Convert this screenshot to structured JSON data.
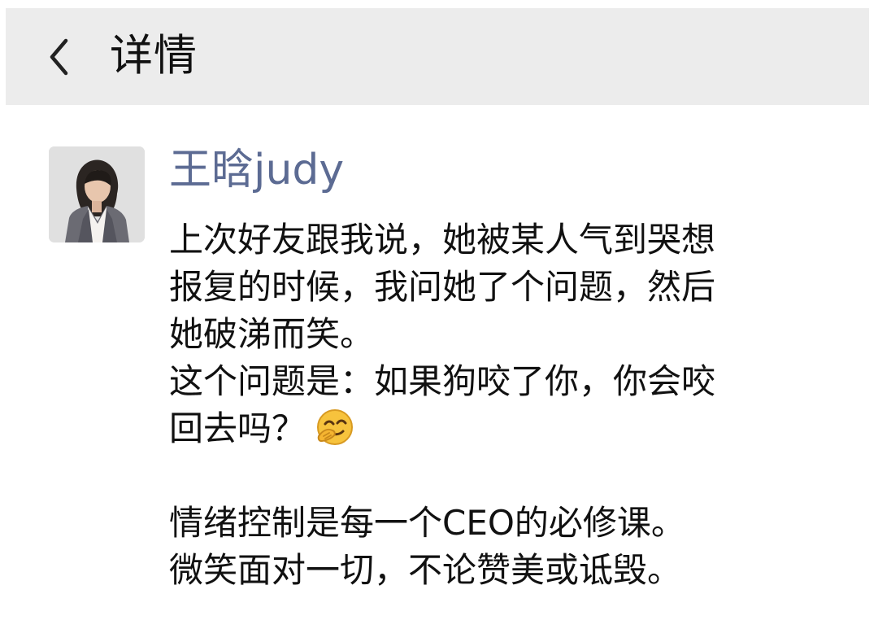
{
  "header": {
    "title": "详情"
  },
  "post": {
    "author": "王晗judy",
    "lines": [
      "上次好友跟我说，她被某人气到哭想",
      "报复的时候，我问她了个问题，然后",
      "她破涕而笑。",
      "这个问题是：如果狗咬了你，你会咬",
      "回去吗？",
      "",
      "情绪控制是每一个CEO的必修课。",
      "微笑面对一切，不论赞美或诋毁。"
    ],
    "emoji": "facepalm-smile-emoji"
  },
  "colors": {
    "header_background": "#ececec",
    "author_name": "#5c6b93",
    "body_text": "#111111"
  }
}
